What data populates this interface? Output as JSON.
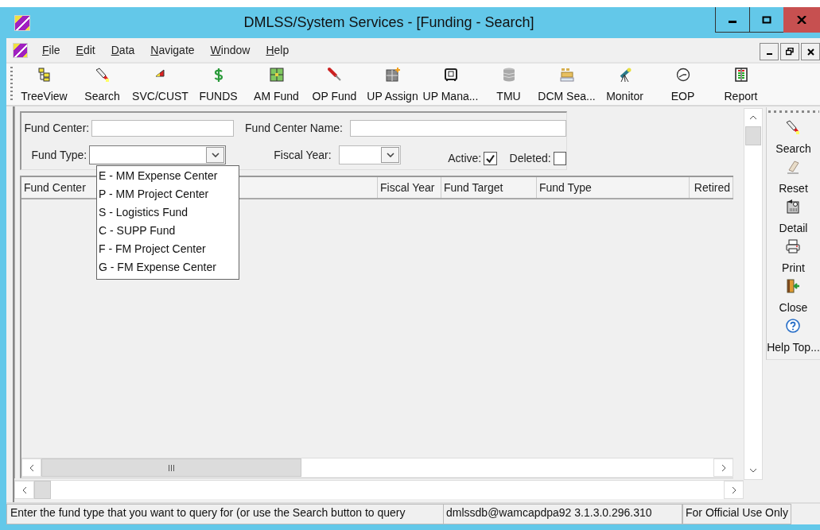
{
  "window": {
    "title": "DMLSS/System Services - [Funding - Search]"
  },
  "menu": [
    {
      "label": "File"
    },
    {
      "label": "Edit"
    },
    {
      "label": "Data"
    },
    {
      "label": "Navigate"
    },
    {
      "label": "Window"
    },
    {
      "label": "Help"
    }
  ],
  "toolbar": [
    {
      "label": "TreeView",
      "kind": "tree"
    },
    {
      "label": "Search",
      "kind": "flashlight"
    },
    {
      "label": "SVC/CUST",
      "kind": "wedge"
    },
    {
      "label": "FUNDS",
      "kind": "dollar"
    },
    {
      "label": "AM Fund",
      "kind": "grid"
    },
    {
      "label": "OP Fund",
      "kind": "screwdriver"
    },
    {
      "label": "UP Assign",
      "kind": "cabinet"
    },
    {
      "label": "UP Mana...",
      "kind": "safe"
    },
    {
      "label": "TMU",
      "kind": "database"
    },
    {
      "label": "DCM Sea...",
      "kind": "boxes"
    },
    {
      "label": "Monitor",
      "kind": "telescope"
    },
    {
      "label": "EOP",
      "kind": "clock"
    },
    {
      "label": "Report",
      "kind": "report"
    }
  ],
  "form": {
    "fund_center": {
      "label": "Fund Center:"
    },
    "fund_center_name": {
      "label": "Fund Center Name:"
    },
    "fund_type": {
      "label": "Fund Type:",
      "expanded": true,
      "options": [
        {
          "label": "E - MM Expense Center"
        },
        {
          "label": "P - MM Project Center"
        },
        {
          "label": "S - Logistics Fund"
        },
        {
          "label": "C - SUPP Fund"
        },
        {
          "label": "F - FM Project Center"
        },
        {
          "label": "G - FM Expense Center"
        }
      ]
    },
    "fiscal_year": {
      "label": "Fiscal Year:"
    },
    "active": {
      "label": "Active:",
      "checked": true
    },
    "deleted": {
      "label": "Deleted:",
      "checked": false
    }
  },
  "table": {
    "columns": [
      "Fund Center",
      "Fiscal Year",
      "Fund Target",
      "Fund Type",
      "Retired"
    ]
  },
  "side_toolbar": [
    {
      "label": "Search",
      "kind": "flashlight"
    },
    {
      "label": "Reset",
      "kind": "eraser"
    },
    {
      "label": "Detail",
      "kind": "detail"
    },
    {
      "label": "Print",
      "kind": "printer"
    },
    {
      "label": "Close",
      "kind": "door"
    },
    {
      "label": "Help Top...",
      "kind": "help"
    }
  ],
  "status_bar": {
    "message": "Enter the fund type that you want to query for (or use the Search button to query",
    "connection": "dmlssdb@wamcapdpa92  3.1.3.0.296.310",
    "notice": "For Official Use Only"
  }
}
